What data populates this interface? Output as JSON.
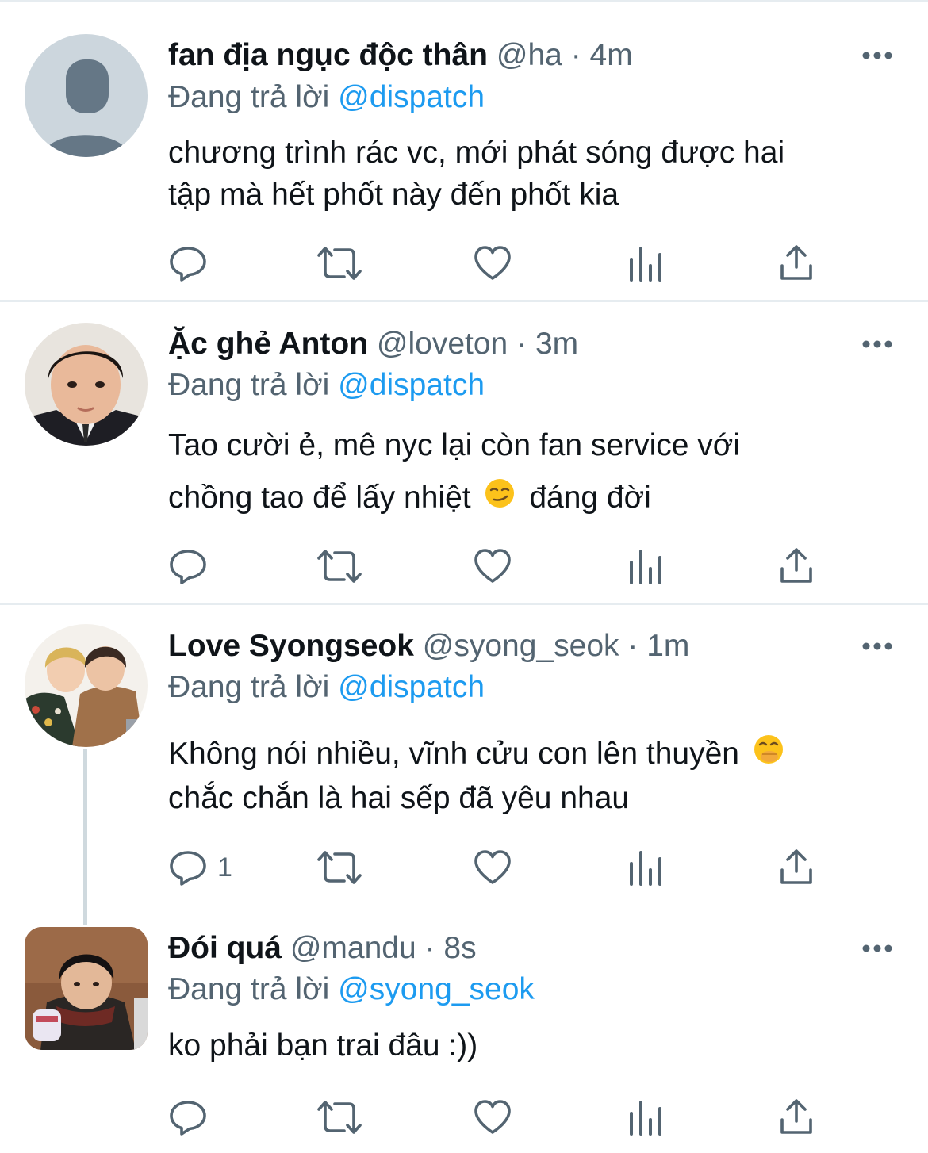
{
  "tweets": [
    {
      "display_name": "fan địa ngục độc thân",
      "handle": "@ha",
      "time": "4m",
      "reply_prefix": "Đang trả lời",
      "reply_to": "@dispatch",
      "text_lines": [
        "chương trình rác vc, mới phát sóng được hai",
        "tập mà hết phốt này đến phốt kia"
      ],
      "reply_count": ""
    },
    {
      "display_name": "Ặc ghẻ Anton",
      "handle": "@loveton",
      "time": "3m",
      "reply_prefix": "Đang trả lời",
      "reply_to": "@dispatch",
      "text_lines": [
        "Tao cười ẻ, mê nyc lại còn fan service với",
        "chồng tao để lấy nhiệt",
        "đáng đời"
      ],
      "reply_count": ""
    },
    {
      "display_name": "Love Syongseok",
      "handle": "@syong_seok",
      "time": "1m",
      "reply_prefix": "Đang trả lời",
      "reply_to": "@dispatch",
      "text_lines": [
        "Không nói nhiều, vĩnh cửu con lên thuyền",
        "chắc chắn là hai sếp đã yêu nhau"
      ],
      "reply_count": "1"
    },
    {
      "display_name": "Đói quá",
      "handle": "@mandu",
      "time": "8s",
      "reply_prefix": "Đang trả lời",
      "reply_to": "@syong_seok",
      "text_lines": [
        "ko phải bạn trai đâu :))"
      ],
      "reply_count": ""
    }
  ],
  "separator": "·",
  "icons": [
    "reply-icon",
    "retweet-icon",
    "like-icon",
    "analytics-icon",
    "share-icon",
    "more-icon"
  ],
  "colors": {
    "link": "#1d9bf0",
    "muted": "#536471",
    "text": "#0f1419"
  }
}
